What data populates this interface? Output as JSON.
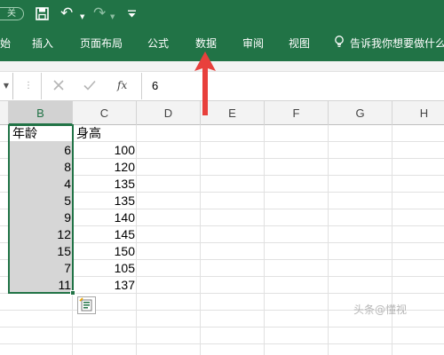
{
  "quick_access": {
    "autosave_text": "关",
    "icons": [
      "save-icon",
      "undo-icon",
      "redo-icon",
      "customize-qat-icon"
    ]
  },
  "ribbon": {
    "tabs": [
      "始",
      "插入",
      "页面布局",
      "公式",
      "数据",
      "审阅",
      "视图"
    ],
    "tell_me": "告诉我你想要做什么"
  },
  "formula_bar": {
    "cancel_symbol": "✕",
    "enter_symbol": "✓",
    "fx_label": "fx",
    "value": "6"
  },
  "grid": {
    "columns": [
      "B",
      "C",
      "D",
      "E",
      "F",
      "G",
      "H"
    ],
    "selected_column": "B",
    "headers": {
      "B": "年龄",
      "C": "身高"
    },
    "rows": [
      {
        "B": "6",
        "C": "100"
      },
      {
        "B": "8",
        "C": "120"
      },
      {
        "B": "4",
        "C": "135"
      },
      {
        "B": "5",
        "C": "135"
      },
      {
        "B": "9",
        "C": "140"
      },
      {
        "B": "12",
        "C": "145"
      },
      {
        "B": "15",
        "C": "150"
      },
      {
        "B": "7",
        "C": "105"
      },
      {
        "B": "11",
        "C": "137"
      }
    ]
  },
  "colors": {
    "ribbon": "#217346",
    "selection_fill": "#d6d6d6",
    "annotation_arrow": "#e8403c"
  },
  "watermark_text": "头条@懂视"
}
